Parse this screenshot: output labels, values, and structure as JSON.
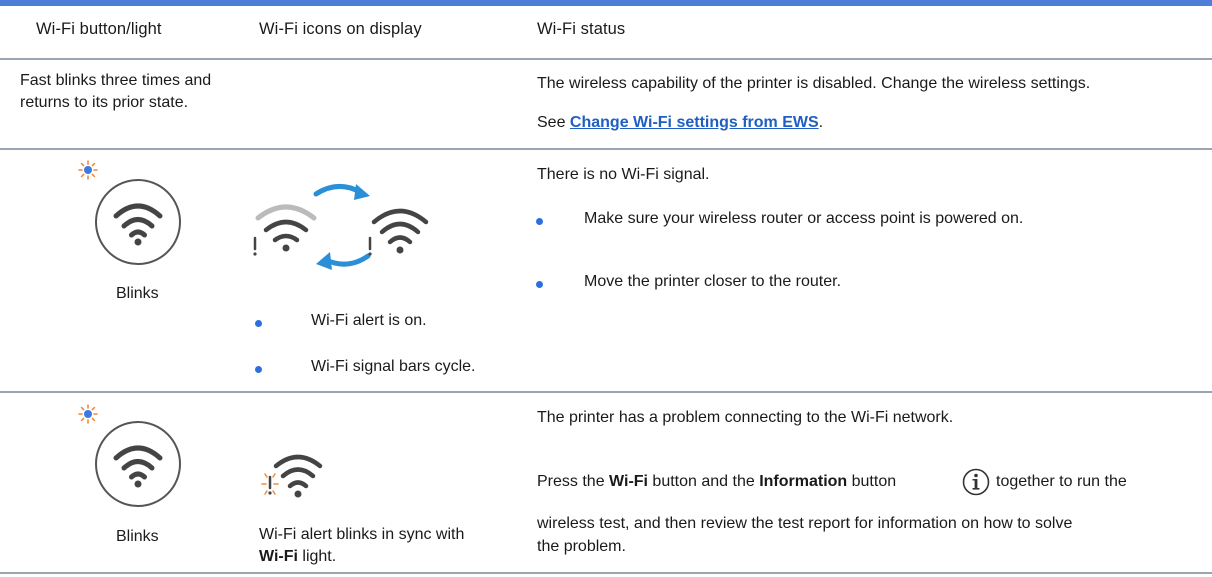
{
  "headers": {
    "col1": "Wi-Fi button/light",
    "col2": "Wi-Fi icons on display",
    "col3": "Wi-Fi status"
  },
  "row1": {
    "button_light": "Fast blinks three times and returns to its prior state.",
    "status": "The wireless capability of the printer is disabled. Change the wireless settings.",
    "see_prefix": "See ",
    "link_text": "Change Wi-Fi settings from EWS",
    "see_suffix": "."
  },
  "row2": {
    "button_caption": "Blinks",
    "display_bullets": [
      "Wi-Fi alert is on.",
      "Wi-Fi signal bars cycle."
    ],
    "status": "There is no Wi-Fi signal.",
    "status_bullets": [
      "Make sure your wireless router or access point is powered on.",
      "Move the printer closer to the router."
    ]
  },
  "row3": {
    "button_caption": "Blinks",
    "display_text": "Wi-Fi alert blinks in sync with",
    "display_bold": "Wi-Fi",
    "display_suffix": " light.",
    "status": "The printer has a problem connecting to the Wi-Fi network.",
    "press": "Press the ",
    "wifi_bold": "Wi-Fi",
    "mid": " button and the ",
    "info_bold": "Information",
    "mid2": " button",
    "tail": " together to run the",
    "line2": "wireless test, and then review the test report for information on how to solve",
    "line3": "the problem."
  },
  "icons": {
    "wifi": "wifi-icon",
    "light": "blink-light-icon",
    "alert": "wifi-alert-icon",
    "cycle": "cycle-arrows-icon",
    "info": "information-icon"
  },
  "colors": {
    "accent": "#4e7fd8",
    "link": "#1f5fc2",
    "bullet": "#2d6fde",
    "light_blue": "#3a7be0",
    "light_orange": "#f0883a"
  }
}
